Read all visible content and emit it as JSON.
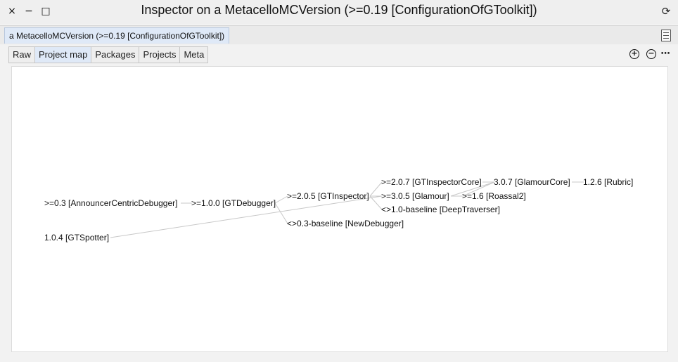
{
  "window": {
    "title": "Inspector on a MetacelloMCVersion (>=0.19 [ConfigurationOfGToolkit])",
    "close_glyph": "×",
    "minimize_glyph": "−",
    "maximize_glyph": "□",
    "refresh_glyph": "⟳"
  },
  "page_tab": {
    "label": "a MetacelloMCVersion (>=0.19 [ConfigurationOfGToolkit])",
    "icon": "page-list-icon"
  },
  "tabs": [
    {
      "label": "Raw"
    },
    {
      "label": "Project map",
      "active": true
    },
    {
      "label": "Packages"
    },
    {
      "label": "Projects"
    },
    {
      "label": "Meta"
    }
  ],
  "tools": {
    "zoom_in": "+",
    "zoom_out": "−",
    "more": "⋯"
  },
  "graph": {
    "nodes": [
      {
        "id": "announcer",
        "label": ">=0.3 [AnnouncerCentricDebugger]"
      },
      {
        "id": "gtdebugger",
        "label": ">=1.0.0 [GTDebugger]"
      },
      {
        "id": "gtinspector",
        "label": ">=2.0.5 [GTInspector]"
      },
      {
        "id": "newdebugger",
        "label": "<>0.3-baseline [NewDebugger]"
      },
      {
        "id": "gtinspectorcore",
        "label": ">=2.0.7 [GTInspectorCore]"
      },
      {
        "id": "glamour",
        "label": ">=3.0.5 [Glamour]"
      },
      {
        "id": "deeptraverser",
        "label": "<>1.0-baseline [DeepTraverser]"
      },
      {
        "id": "glamourcore",
        "label": "3.0.7 [GlamourCore]"
      },
      {
        "id": "roassal2",
        "label": ">=1.6 [Roassal2]"
      },
      {
        "id": "rubric",
        "label": "1.2.6 [Rubric]"
      },
      {
        "id": "gtspotter",
        "label": "1.0.4 [GTSpotter]"
      }
    ]
  }
}
